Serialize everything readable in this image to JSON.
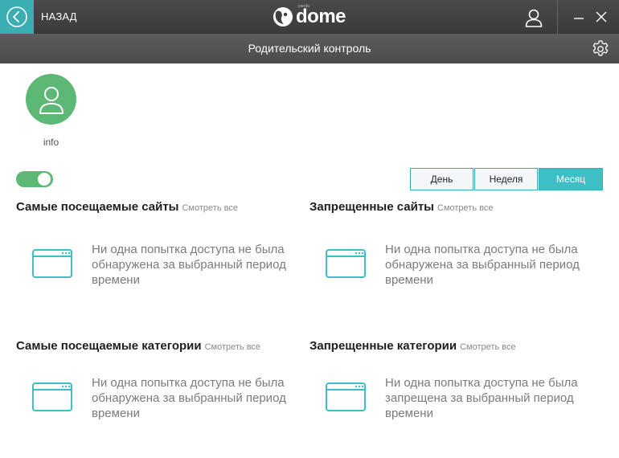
{
  "header": {
    "back_label": "НАЗАД",
    "logo_text": "dome",
    "logo_small": "panda"
  },
  "titlebar": {
    "title": "Родительский контроль"
  },
  "profile": {
    "name": "info",
    "color": "#5cb874"
  },
  "toggle": {
    "on": true
  },
  "period": {
    "options": [
      "День",
      "Неделя",
      "Месяц"
    ],
    "selected": "Месяц"
  },
  "sections": {
    "top_sites": {
      "title": "Самые посещаемые сайты",
      "link": "Смотреть все",
      "empty": "Ни одна попытка доступа не была обнаружена за выбранный период времени"
    },
    "blocked_sites": {
      "title": "Запрещенные сайты",
      "link": "Смотреть все",
      "empty": "Ни одна попытка доступа не была обнаружена за выбранный период времени"
    },
    "top_categories": {
      "title": "Самые посещаемые категории",
      "link": "Смотреть все",
      "empty": "Ни одна попытка доступа не была обнаружена за выбранный период времени"
    },
    "blocked_categories": {
      "title": "Запрещенные категории",
      "link": "Смотреть все",
      "empty": "Ни одна попытка доступа не была запрещена за выбранный период времени"
    }
  },
  "colors": {
    "accent": "#3ebfc6",
    "green": "#5cb874",
    "topbar": "#3f3f3f"
  },
  "icons": [
    "back-arrow-icon",
    "panda-logo-icon",
    "user-icon",
    "minimize-icon",
    "close-icon",
    "gear-icon",
    "avatar-user-icon",
    "browser-window-icon"
  ]
}
